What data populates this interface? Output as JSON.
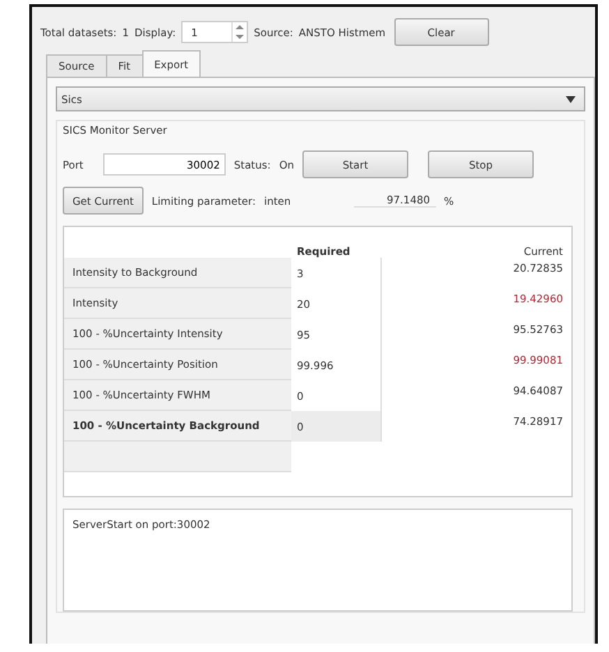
{
  "toolbar": {
    "total_label": "Total datasets:",
    "total_value": "1",
    "display_label": "Display:",
    "display_value": "1",
    "source_label": "Source:",
    "source_value": "ANSTO Histmem",
    "clear_button": "Clear"
  },
  "tabs": [
    {
      "label": "Source",
      "selected": false
    },
    {
      "label": "Fit",
      "selected": false
    },
    {
      "label": "Export",
      "selected": true
    }
  ],
  "source_dropdown": {
    "value": "Sics"
  },
  "group": {
    "title": "SICS Monitor Server",
    "port_label": "Port",
    "port_value": "30002",
    "status_label": "Status:",
    "status_value": "On",
    "start_button": "Start",
    "stop_button": "Stop",
    "get_current_button": "Get Current",
    "limiting_label": "Limiting parameter:",
    "limiting_value": "inten",
    "percent_value": "97.1480",
    "percent_unit": "%"
  },
  "table": {
    "columns": [
      "Required",
      "Current"
    ],
    "rows": [
      {
        "name": "Intensity to Background",
        "required": "3",
        "current": "20.72835",
        "alert": false,
        "selected": false
      },
      {
        "name": "Intensity",
        "required": "20",
        "current": "19.42960",
        "alert": true,
        "selected": false
      },
      {
        "name": "100 - %Uncertainty Intensity",
        "required": "95",
        "current": "95.52763",
        "alert": false,
        "selected": false
      },
      {
        "name": "100 - %Uncertainty Position",
        "required": "99.996",
        "current": "99.99081",
        "alert": true,
        "selected": false
      },
      {
        "name": "100 - %Uncertainty FWHM",
        "required": "0",
        "current": "94.64087",
        "alert": false,
        "selected": false
      },
      {
        "name": "100 - %Uncertainty Background",
        "required": "0",
        "current": "74.28917",
        "alert": false,
        "selected": true
      }
    ]
  },
  "log": {
    "text": "ServerStart on port:30002"
  }
}
